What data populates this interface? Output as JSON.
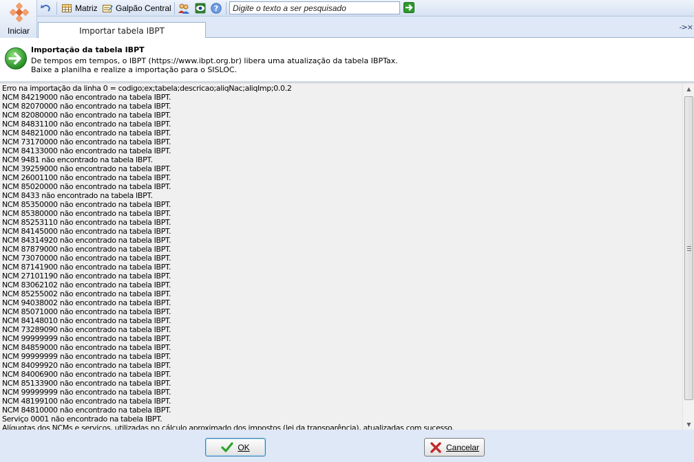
{
  "toolbar": {
    "start_label": "Iniciar",
    "matriz_label": "Matriz",
    "galpao_label": "Galpão Central",
    "search_placeholder": "Digite o texto a ser pesquisado"
  },
  "tab": {
    "label": "Importar tabela IBPT",
    "close_glyph": "->×"
  },
  "header": {
    "title": "Importação da tabela IBPT",
    "line1": "De tempos em tempos, o IBPT (https://www.ibpt.org.br) libera uma atualização da tabela IBPTax.",
    "line2": "Baixe a planilha e realize a importação para o SISLOC."
  },
  "log_lines": [
    "Erro na importação da linha 0 = codigo;ex;tabela;descricao;aliqNac;aliqImp;0.0.2",
    "NCM 84219000 não encontrado na tabela IBPT.",
    "NCM 82070000 não encontrado na tabela IBPT.",
    "NCM 82080000 não encontrado na tabela IBPT.",
    "NCM 84831100 não encontrado na tabela IBPT.",
    "NCM 84821000 não encontrado na tabela IBPT.",
    "NCM 73170000 não encontrado na tabela IBPT.",
    "NCM 84133000 não encontrado na tabela IBPT.",
    "NCM 9481 não encontrado na tabela IBPT.",
    "NCM 39259000 não encontrado na tabela IBPT.",
    "NCM 26001100 não encontrado na tabela IBPT.",
    "NCM 85020000 não encontrado na tabela IBPT.",
    "NCM 8433 não encontrado na tabela IBPT.",
    "NCM 85350000 não encontrado na tabela IBPT.",
    "NCM 85380000 não encontrado na tabela IBPT.",
    "NCM 85253110 não encontrado na tabela IBPT.",
    "NCM 84145000 não encontrado na tabela IBPT.",
    "NCM 84314920 não encontrado na tabela IBPT.",
    "NCM 87879000 não encontrado na tabela IBPT.",
    "NCM 73070000 não encontrado na tabela IBPT.",
    "NCM 87141900 não encontrado na tabela IBPT.",
    "NCM 27101190 não encontrado na tabela IBPT.",
    "NCM 83062102 não encontrado na tabela IBPT.",
    "NCM 85255002 não encontrado na tabela IBPT.",
    "NCM 94038002 não encontrado na tabela IBPT.",
    "NCM 85071000 não encontrado na tabela IBPT.",
    "NCM 84148010 não encontrado na tabela IBPT.",
    "NCM 73289090 não encontrado na tabela IBPT.",
    "NCM 99999999 não encontrado na tabela IBPT.",
    "NCM 84859000 não encontrado na tabela IBPT.",
    "NCM 99999999 não encontrado na tabela IBPT.",
    "NCM 84099920 não encontrado na tabela IBPT.",
    "NCM 84006900 não encontrado na tabela IBPT.",
    "NCM 85133900 não encontrado na tabela IBPT.",
    "NCM 99999999 não encontrado na tabela IBPT.",
    "NCM 48199100 não encontrado na tabela IBPT.",
    "NCM 84810000 não encontrado na tabela IBPT.",
    "Serviço 0001 não encontrado na tabela IBPT.",
    "Alíquotas dos NCMs e serviços, utilizadas no cálculo aproximado dos impostos (lei da transparência), atualizadas com sucesso."
  ],
  "buttons": {
    "ok": "OK",
    "cancel": "Cancelar"
  },
  "colors": {
    "frame": "#dfe8f6",
    "log_bg": "#f0f0f0",
    "accent_green": "#2aa52a",
    "cancel_red": "#c0282a"
  }
}
